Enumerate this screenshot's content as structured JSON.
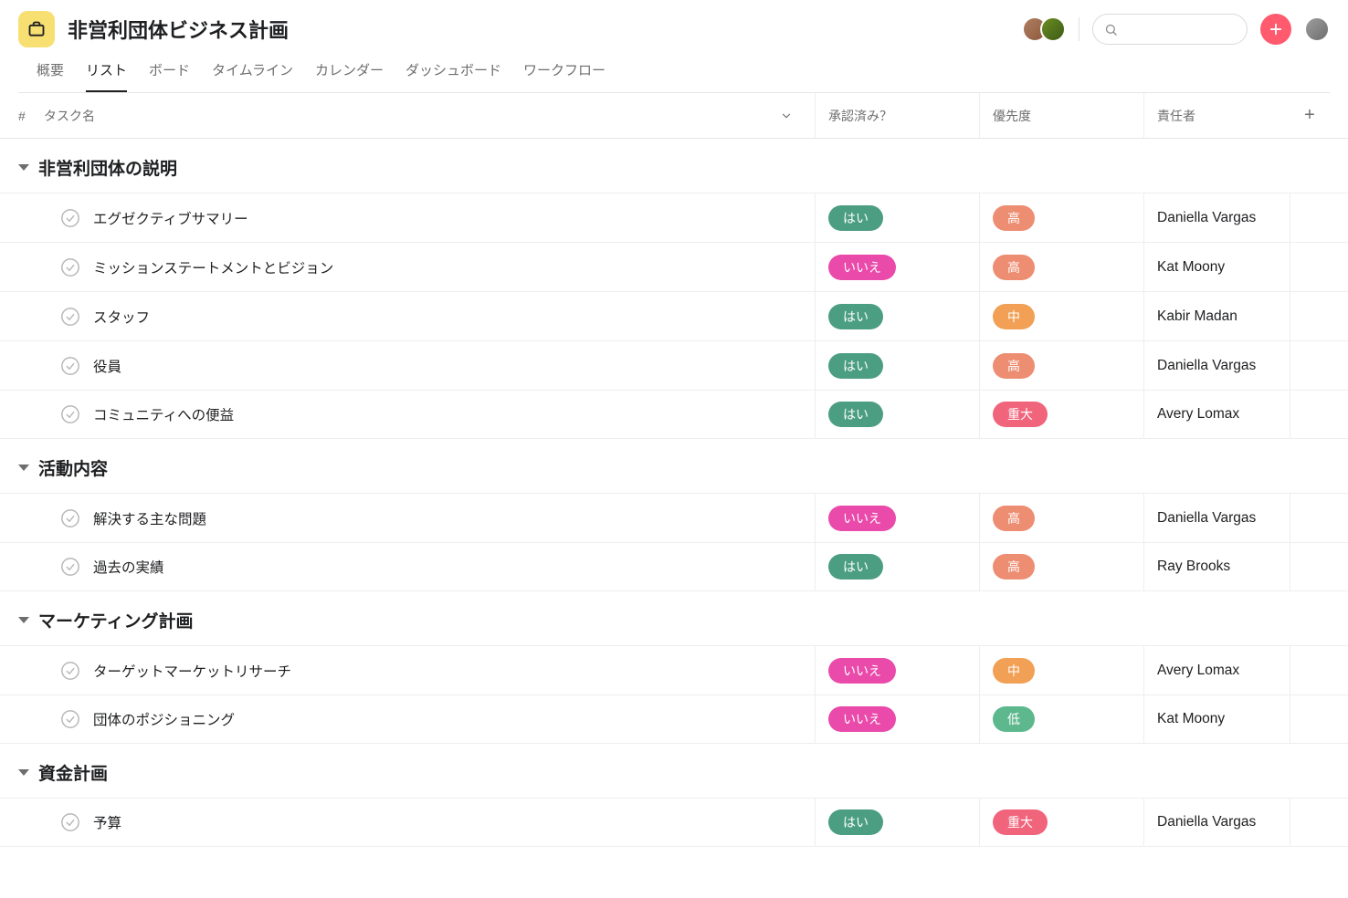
{
  "project": {
    "title": "非営利団体ビジネス計画"
  },
  "tabs": [
    {
      "label": "概要"
    },
    {
      "label": "リスト",
      "active": true
    },
    {
      "label": "ボード"
    },
    {
      "label": "タイムライン"
    },
    {
      "label": "カレンダー"
    },
    {
      "label": "ダッシュボード"
    },
    {
      "label": "ワークフロー"
    }
  ],
  "columns": {
    "num": "#",
    "task_name": "タスク名",
    "approved": "承認済み？",
    "priority": "優先度",
    "owner": "責任者"
  },
  "approval_labels": {
    "yes": "はい",
    "no": "いいえ"
  },
  "priority_labels": {
    "high": "高",
    "med": "中",
    "low": "低",
    "crit": "重大"
  },
  "sections": [
    {
      "title": "非営利団体の説明",
      "rows": [
        {
          "name": "エグゼクティブサマリー",
          "approved": "yes",
          "priority": "high",
          "owner": "Daniella Vargas"
        },
        {
          "name": "ミッションステートメントとビジョン",
          "approved": "no",
          "priority": "high",
          "owner": "Kat Moony"
        },
        {
          "name": "スタッフ",
          "approved": "yes",
          "priority": "med",
          "owner": "Kabir Madan"
        },
        {
          "name": "役員",
          "approved": "yes",
          "priority": "high",
          "owner": "Daniella Vargas"
        },
        {
          "name": "コミュニティへの便益",
          "approved": "yes",
          "priority": "crit",
          "owner": "Avery Lomax"
        }
      ]
    },
    {
      "title": "活動内容",
      "rows": [
        {
          "name": "解決する主な問題",
          "approved": "no",
          "priority": "high",
          "owner": "Daniella Vargas"
        },
        {
          "name": "過去の実績",
          "approved": "yes",
          "priority": "high",
          "owner": "Ray Brooks"
        }
      ]
    },
    {
      "title": "マーケティング計画",
      "rows": [
        {
          "name": "ターゲットマーケットリサーチ",
          "approved": "no",
          "priority": "med",
          "owner": "Avery Lomax"
        },
        {
          "name": "団体のポジショニング",
          "approved": "no",
          "priority": "low",
          "owner": "Kat Moony"
        }
      ]
    },
    {
      "title": "資金計画",
      "rows": [
        {
          "name": "予算",
          "approved": "yes",
          "priority": "crit",
          "owner": "Daniella Vargas"
        }
      ]
    }
  ]
}
